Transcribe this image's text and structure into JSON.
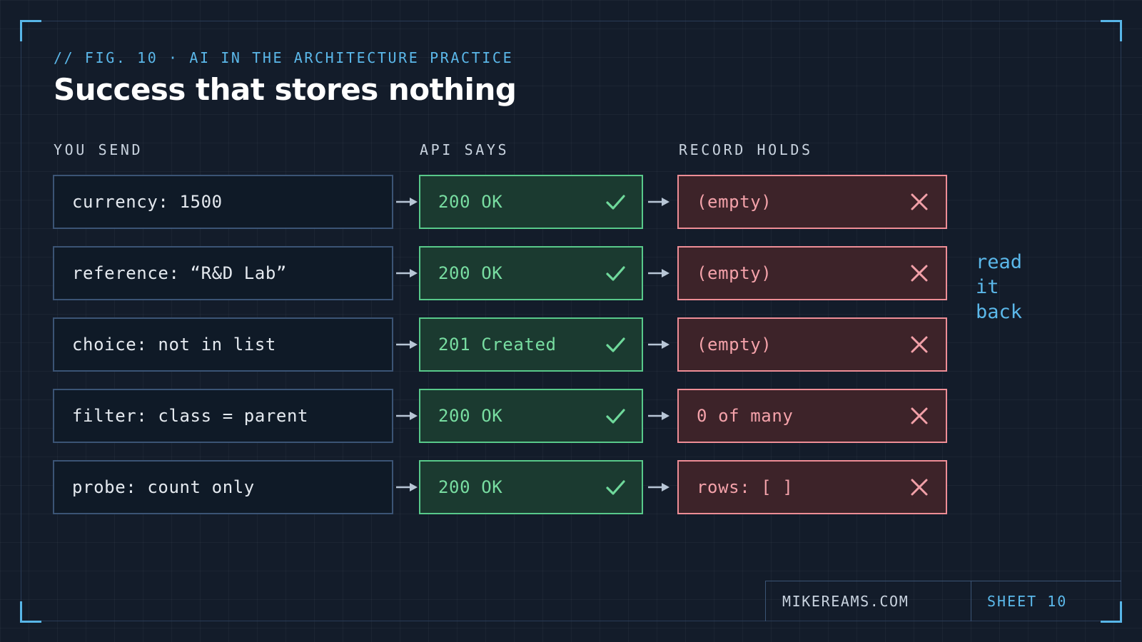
{
  "header": {
    "eyebrow": "// FIG. 10 · AI IN THE ARCHITECTURE PRACTICE",
    "title": "Success that stores nothing"
  },
  "columns": {
    "send": "YOU SEND",
    "api": "API SAYS",
    "record": "RECORD HOLDS"
  },
  "rows": [
    {
      "send": "currency: 1500",
      "api": "200 OK",
      "record": "(empty)"
    },
    {
      "send": "reference: “R&D Lab”",
      "api": "200 OK",
      "record": "(empty)"
    },
    {
      "send": "choice: not in list",
      "api": "201 Created",
      "record": "(empty)"
    },
    {
      "send": "filter: class = parent",
      "api": "200 OK",
      "record": "0 of many"
    },
    {
      "send": "probe: count only",
      "api": "200 OK",
      "record": "rows: [ ]"
    }
  ],
  "side_note": [
    "read",
    "it",
    "back"
  ],
  "footer": {
    "site": "MIKEREAMS.COM",
    "sheet": "SHEET 10"
  },
  "icons": {
    "api_status": "check-icon",
    "record_status": "cross-icon",
    "flow": "arrow-right-icon"
  },
  "colors": {
    "accent": "#5bb8ea",
    "ok_border": "#58c98a",
    "ok_fill": "#1b3a30",
    "fail_border": "#ee8d96",
    "fail_fill": "#3d2329",
    "send_border": "#3b5475"
  }
}
